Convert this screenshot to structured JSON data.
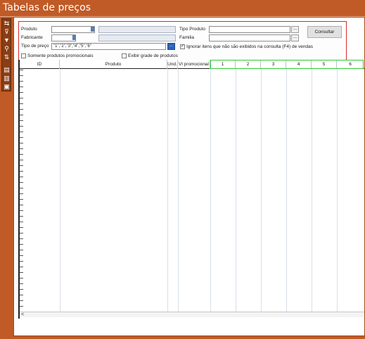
{
  "window": {
    "title": "Tabelas de preços"
  },
  "toolbar": {
    "icons": [
      "refresh-icon",
      "filter-icon",
      "funnel-icon",
      "search-icon",
      "sort-icon",
      "print-icon",
      "document-icon",
      "save-icon"
    ]
  },
  "filters": {
    "produto_label": "Produto",
    "fabricante_label": "Fabricante",
    "tipo_preco_label": "Tipo de preço",
    "tipo_preco_value": "\"1\",\"2\",\"3\",\"4\",\"5\",\"6\"",
    "tipo_produto_label": "Tipo Produto",
    "familia_label": "Familia",
    "ignorar_label": "Ignorar itens que não são exibidos na consulta (F4) de vendas",
    "ignorar_checked": true,
    "somente_promo_label": "Somente produtos promocionais",
    "exibir_grade_label": "Exibir grade de produtos",
    "ellipsis": "...",
    "consultar_label": "Consultar"
  },
  "grid": {
    "columns": [
      "ID",
      "Produto",
      "Und.",
      "Vl promocional",
      "1",
      "2",
      "3",
      "4",
      "5",
      "6"
    ],
    "scroll_left": "<"
  },
  "colors": {
    "accent": "#c05a26",
    "filter_border": "#d42a2a",
    "highlight": "#2ecc2e"
  }
}
